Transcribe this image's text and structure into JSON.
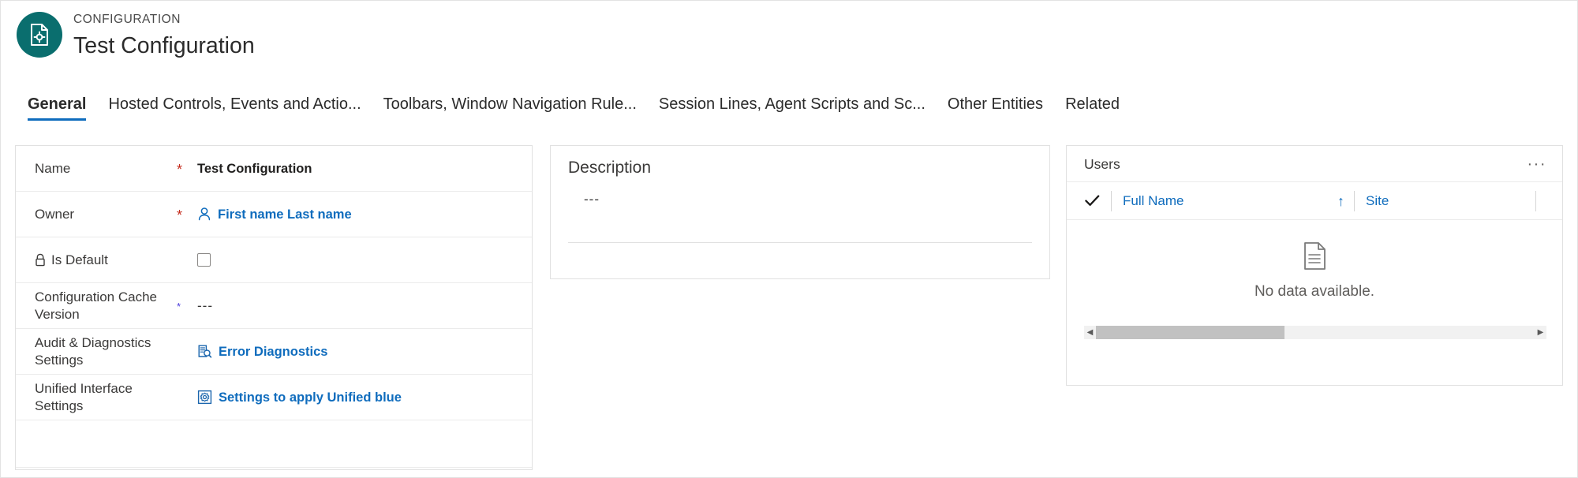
{
  "header": {
    "eyebrow": "CONFIGURATION",
    "title": "Test Configuration",
    "icon": "document-gear-icon",
    "icon_bg": "#0a6e6e"
  },
  "tabs": [
    {
      "label": "General",
      "active": true
    },
    {
      "label": "Hosted Controls, Events and Actio...",
      "active": false
    },
    {
      "label": "Toolbars, Window Navigation Rule...",
      "active": false
    },
    {
      "label": "Session Lines, Agent Scripts and Sc...",
      "active": false
    },
    {
      "label": "Other Entities",
      "active": false
    },
    {
      "label": "Related",
      "active": false
    }
  ],
  "general": {
    "rows": [
      {
        "label": "Name",
        "required": "*",
        "value": "Test Configuration",
        "type": "text-strong"
      },
      {
        "label": "Owner",
        "required": "*",
        "value": "First name Last name",
        "type": "link-person",
        "icon": "person-icon"
      },
      {
        "label": "Is Default",
        "required": "",
        "value": "",
        "type": "checkbox",
        "icon": "lock-icon",
        "checked": false
      },
      {
        "label": "Configuration Cache Version",
        "required": "*",
        "value": "---",
        "type": "text-dim"
      },
      {
        "label": "Audit & Diagnostics Settings",
        "required": "",
        "value": "Error Diagnostics",
        "type": "link-icon",
        "icon": "document-search-icon"
      },
      {
        "label": "Unified Interface Settings",
        "required": "",
        "value": "Settings to apply Unified blue",
        "type": "link-icon",
        "icon": "gear-square-icon"
      }
    ]
  },
  "description": {
    "label": "Description",
    "value": "---"
  },
  "users": {
    "title": "Users",
    "more_label": "···",
    "columns": [
      {
        "label": "Full Name",
        "sort": "↑"
      },
      {
        "label": "Site",
        "sort": ""
      }
    ],
    "empty_text": "No data available.",
    "empty_icon": "document-lines-icon",
    "scroll_left_arrow": "◀",
    "scroll_right_arrow": "▶"
  },
  "colors": {
    "accent": "#0f6cbd",
    "teal": "#0a6e6e",
    "required": "#c42b1c",
    "text": "#201f1e",
    "muted": "#605e5c"
  }
}
